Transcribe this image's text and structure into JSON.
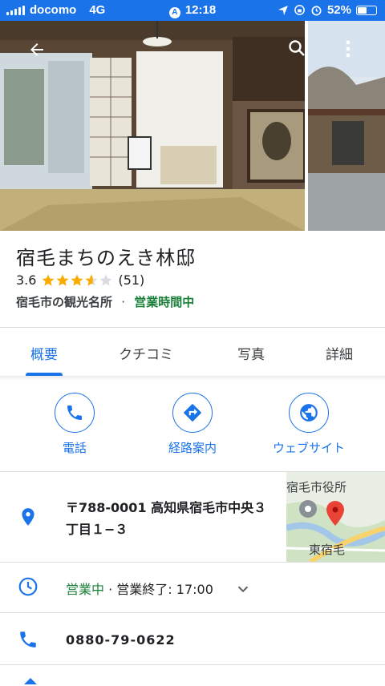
{
  "status_bar": {
    "carrier": "docomo",
    "network": "4G",
    "time": "12:18",
    "battery_percent": "52%",
    "battery_level": 0.52
  },
  "place": {
    "name": "宿毛まちのえき林邸",
    "rating": "3.6",
    "rating_value": 3.6,
    "review_count": "(51)",
    "category": "宿毛市の観光名所",
    "separator": "·",
    "open_status": "営業時間中"
  },
  "tabs": [
    {
      "label": "概要",
      "active": true
    },
    {
      "label": "クチコミ",
      "active": false
    },
    {
      "label": "写真",
      "active": false
    },
    {
      "label": "詳細",
      "active": false
    }
  ],
  "actions": {
    "call": "電話",
    "directions": "経路案内",
    "website": "ウェブサイト"
  },
  "address": {
    "line1": "〒788-0001 高知県宿毛市中央３",
    "line2": "丁目１−３"
  },
  "map": {
    "label_top": "宿毛市役所",
    "label_bottom": "東宿毛"
  },
  "hours": {
    "status": "営業中",
    "separator": " · ",
    "closing": "営業終了: 17:00"
  },
  "phone": "0880-79-0622",
  "colors": {
    "accent": "#1a73e8",
    "open_green": "#188038",
    "star": "#f9ab00"
  }
}
